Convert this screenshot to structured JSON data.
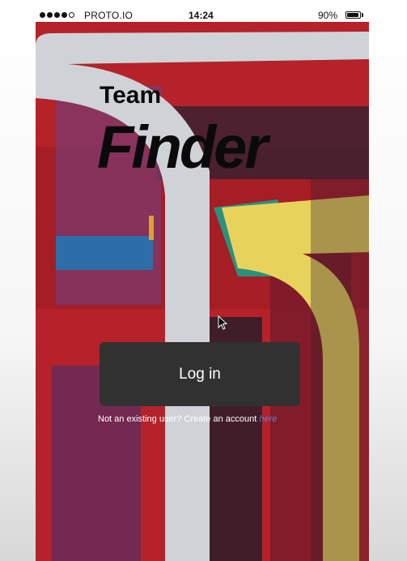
{
  "status_bar": {
    "carrier": "PROTO.IO",
    "time": "14:24",
    "battery_percent": "90%",
    "battery_level": 0.9,
    "signal_bars_filled": 4,
    "signal_bars_total": 5
  },
  "title": {
    "line1": "Team",
    "line2": "Finder"
  },
  "login": {
    "button_label": "Log in"
  },
  "signup": {
    "prompt": "Not an existing user? Create an account ",
    "link_text": "here"
  },
  "colors": {
    "button_bg": "#323131",
    "link": "#5b7fd9",
    "background_red": "#b5222a"
  }
}
